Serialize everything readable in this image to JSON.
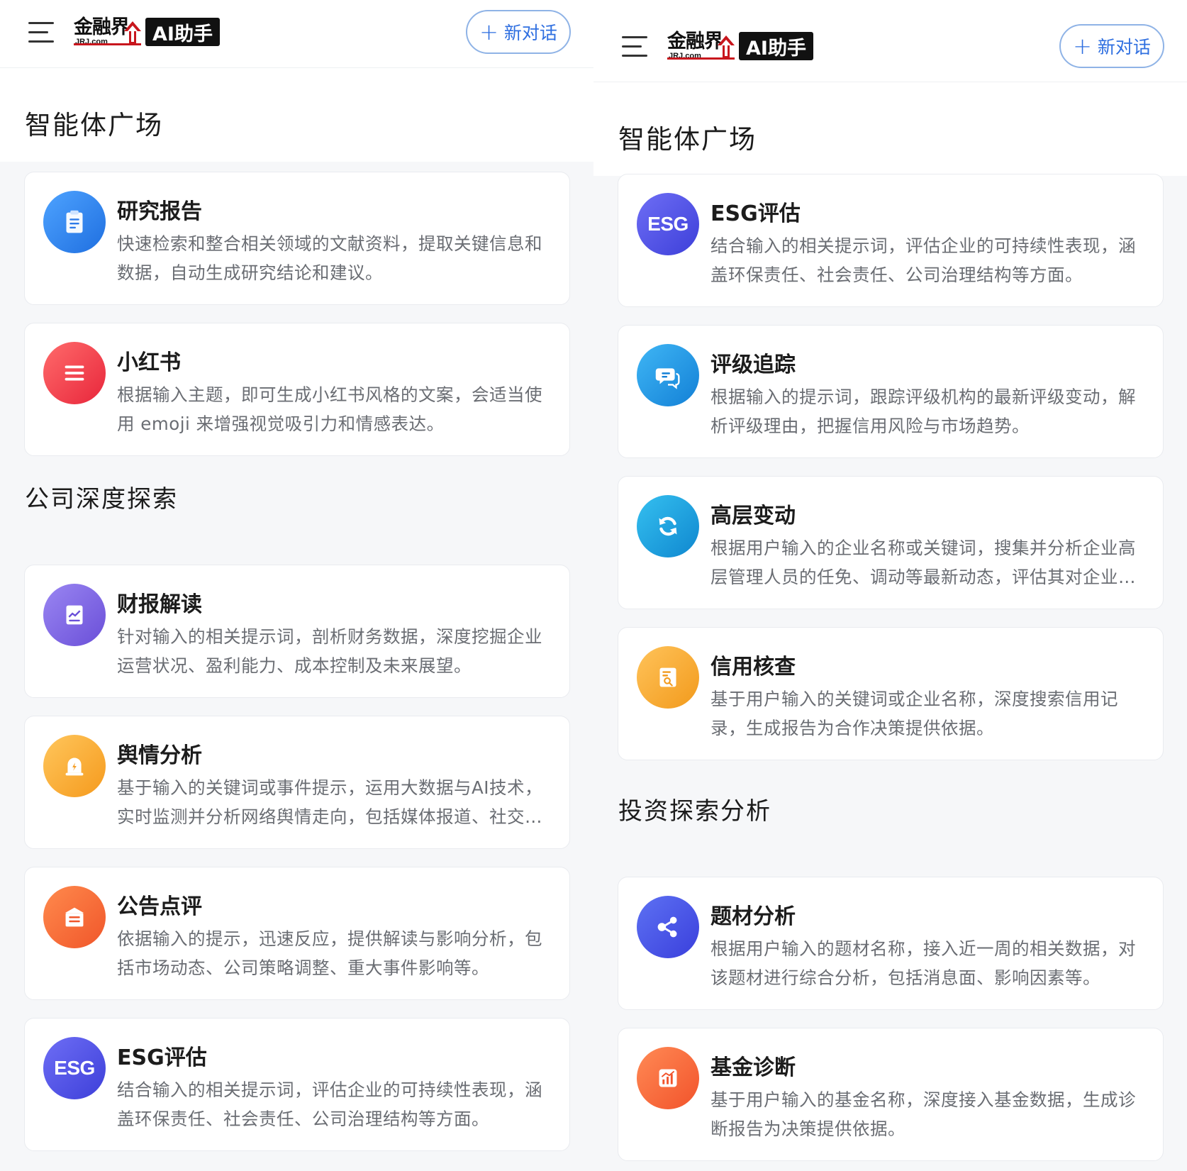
{
  "header": {
    "logo_cn": "金融界",
    "logo_en": "JRJ.com",
    "logo_badge": "AI助手",
    "new_chat_label": "新对话",
    "menu_icon": "hamburger-menu-icon"
  },
  "left": {
    "page_title": "智能体广场",
    "top_cards": [
      {
        "title": "研究报告",
        "desc": "快速检索和整合相关领域的文献资料，提取关键信息和数据，自动生成研究结论和建议。",
        "icon": "clipboard-icon"
      },
      {
        "title": "小红书",
        "desc": "根据输入主题，即可生成小红书风格的文案，会适当使用 emoji 来增强视觉吸引力和情感表达。",
        "icon": "lines-icon"
      }
    ],
    "section_title": "公司深度探索",
    "section_cards": [
      {
        "title": "财报解读",
        "desc": "针对输入的相关提示词，剖析财务数据，深度挖掘企业运营状况、盈利能力、成本控制及未来展望。",
        "icon": "report-chart-icon"
      },
      {
        "title": "舆情分析",
        "desc": "基于输入的关键词或事件提示，运用大数据与AI技术，实时监测并分析网络舆情走向，包括媒体报道、社交平台等多方面信息。",
        "icon": "alarm-bell-icon"
      },
      {
        "title": "公告点评",
        "desc": "依据输入的提示，迅速反应，提供解读与影响分析，包括市场动态、公司策略调整、重大事件影响等。",
        "icon": "announcement-icon"
      },
      {
        "title": "ESG评估",
        "desc": "结合输入的相关提示词，评估企业的可持续性表现，涵盖环保责任、社会责任、公司治理结构等方面。",
        "icon": "esg-icon",
        "icon_text": "ESG"
      }
    ]
  },
  "right": {
    "page_title": "智能体广场",
    "top_cards": [
      {
        "title": "ESG评估",
        "desc": "结合输入的相关提示词，评估企业的可持续性表现，涵盖环保责任、社会责任、公司治理结构等方面。",
        "icon": "esg-icon",
        "icon_text": "ESG"
      },
      {
        "title": "评级追踪",
        "desc": "根据输入的提示词，跟踪评级机构的最新评级变动，解析评级理由，把握信用风险与市场趋势。",
        "icon": "chat-bubbles-icon"
      },
      {
        "title": "高层变动",
        "desc": "根据用户输入的企业名称或关键词，搜集并分析企业高层管理人员的任免、调动等最新动态，评估其对企业的影响。",
        "icon": "refresh-icon"
      },
      {
        "title": "信用核查",
        "desc": "基于用户输入的关键词或企业名称，深度搜索信用记录，生成报告为合作决策提供依据。",
        "icon": "document-search-icon"
      }
    ],
    "section_title": "投资探索分析",
    "section_cards": [
      {
        "title": "题材分析",
        "desc": "根据用户输入的题材名称，接入近一周的相关数据，对该题材进行综合分析，包括消息面、影响因素等。",
        "icon": "share-nodes-icon"
      },
      {
        "title": "基金诊断",
        "desc": "基于用户输入的基金名称，深度接入基金数据，生成诊断报告为决策提供依据。",
        "icon": "bar-chart-icon"
      }
    ]
  }
}
